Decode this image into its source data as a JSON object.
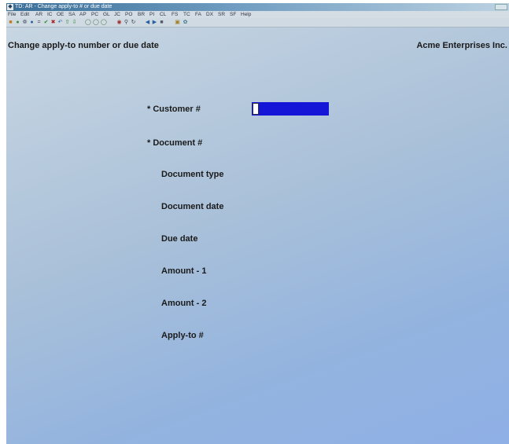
{
  "window": {
    "title": "TD: AR - Change apply-to # or due date"
  },
  "menu": {
    "items": [
      "File",
      "Edit",
      "AR",
      "IC",
      "OE",
      "SA",
      "AP",
      "PC",
      "GL",
      "JC",
      "PO",
      "BR",
      "PI",
      "CL",
      "FS",
      "TC",
      "FA",
      "DX",
      "SR",
      "SF",
      "Help"
    ]
  },
  "toolbar": {
    "icons": [
      "new-icon",
      "refresh-icon",
      "settings-icon",
      "tools-icon",
      "equals-icon",
      "check-icon",
      "cancel-icon",
      "undo-icon",
      "up-icon",
      "down-icon",
      "circle-icon",
      "circle-icon",
      "circle-icon",
      "binoculars-icon",
      "zoom-icon",
      "refresh-icon",
      "prev-icon",
      "next-icon",
      "stop-icon",
      "lock-icon",
      "help-icon"
    ]
  },
  "screen": {
    "title": "Change apply-to number or due date",
    "company": "Acme Enterprises Inc."
  },
  "fields": {
    "customer": "* Customer #",
    "document": "* Document #",
    "document_type": "Document type",
    "document_date": "Document date",
    "due_date": "Due date",
    "amount1": "Amount - 1",
    "amount2": "Amount - 2",
    "apply_to": "Apply-to #"
  },
  "inputs": {
    "customer_value": ""
  },
  "colors": {
    "input_fill": "#1515d8",
    "background": "#a9c0d9"
  }
}
